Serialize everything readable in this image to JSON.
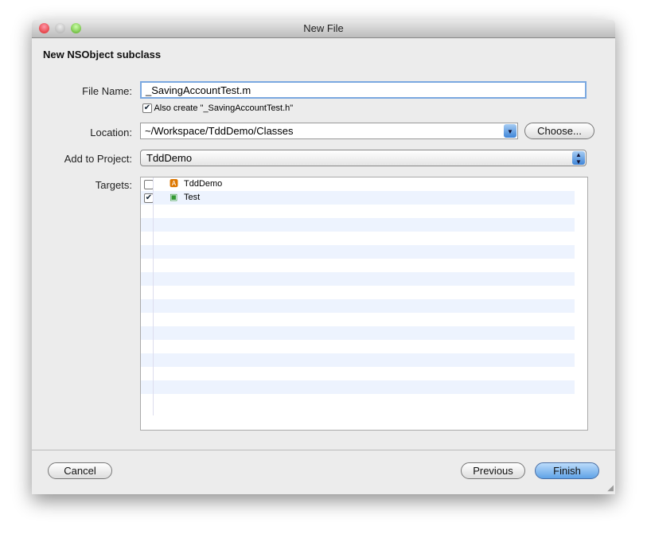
{
  "window": {
    "title": "New File"
  },
  "heading": "New NSObject subclass",
  "file_name": {
    "label": "File Name:",
    "value": "_SavingAccountTest.m"
  },
  "also_create": {
    "label": "Also create \"_SavingAccountTest.h\"",
    "checked": true
  },
  "location": {
    "label": "Location:",
    "value": "~/Workspace/TddDemo/Classes",
    "choose": "Choose..."
  },
  "project": {
    "label": "Add to Project:",
    "value": "TddDemo"
  },
  "targets": {
    "label": "Targets:",
    "items": [
      {
        "name": "TddDemo",
        "checked": false,
        "icon": "app-target-icon"
      },
      {
        "name": "Test",
        "checked": true,
        "icon": "test-bundle-icon"
      }
    ]
  },
  "buttons": {
    "cancel": "Cancel",
    "previous": "Previous",
    "finish": "Finish"
  }
}
